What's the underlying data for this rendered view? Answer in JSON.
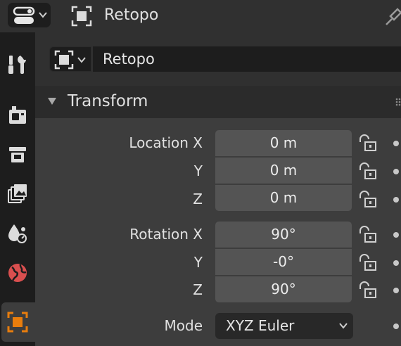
{
  "header": {
    "title": "Retopo"
  },
  "object_name": {
    "value": "Retopo"
  },
  "transform": {
    "title": "Transform",
    "location": {
      "labels": [
        "Location X",
        "Y",
        "Z"
      ],
      "values": [
        "0 m",
        "0 m",
        "0 m"
      ]
    },
    "rotation": {
      "labels": [
        "Rotation X",
        "Y",
        "Z"
      ],
      "values": [
        "90°",
        "-0°",
        "90°"
      ]
    },
    "mode": {
      "label": "Mode",
      "value": "XYZ Euler"
    }
  },
  "tabs": [
    {
      "icon": "tool-icon"
    },
    {
      "icon": "render-icon"
    },
    {
      "icon": "output-icon"
    },
    {
      "icon": "view-layer-icon"
    },
    {
      "icon": "scene-icon"
    },
    {
      "icon": "world-icon"
    },
    {
      "icon": "object-icon",
      "active": true
    }
  ],
  "colors": {
    "accent": "#e87d0d",
    "world": "#d94f4f",
    "panel_bg": "#303030",
    "field_bg": "#545454"
  }
}
